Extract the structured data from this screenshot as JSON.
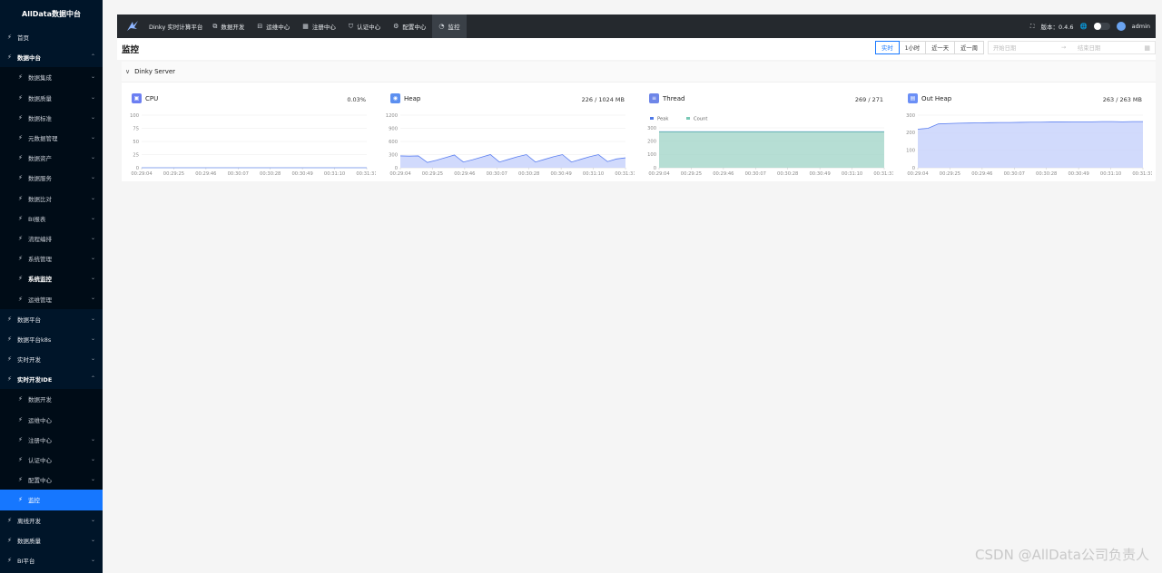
{
  "sidebar": {
    "title": "AllData数据中台",
    "items": [
      {
        "label": "首页",
        "level": 0,
        "expanded": null,
        "bold": false,
        "active": false
      },
      {
        "label": "数据中台",
        "level": 0,
        "expanded": true,
        "bold": true,
        "active": false
      },
      {
        "label": "数据集成",
        "level": 1,
        "expanded": false,
        "bold": false,
        "active": false
      },
      {
        "label": "数据质量",
        "level": 1,
        "expanded": false,
        "bold": false,
        "active": false
      },
      {
        "label": "数据标准",
        "level": 1,
        "expanded": false,
        "bold": false,
        "active": false
      },
      {
        "label": "元数据管理",
        "level": 1,
        "expanded": false,
        "bold": false,
        "active": false
      },
      {
        "label": "数据资产",
        "level": 1,
        "expanded": false,
        "bold": false,
        "active": false
      },
      {
        "label": "数据服务",
        "level": 1,
        "expanded": false,
        "bold": false,
        "active": false
      },
      {
        "label": "数据比对",
        "level": 1,
        "expanded": false,
        "bold": false,
        "active": false
      },
      {
        "label": "BI报表",
        "level": 1,
        "expanded": false,
        "bold": false,
        "active": false
      },
      {
        "label": "流程编排",
        "level": 1,
        "expanded": false,
        "bold": false,
        "active": false
      },
      {
        "label": "系统管理",
        "level": 1,
        "expanded": false,
        "bold": false,
        "active": false
      },
      {
        "label": "系统监控",
        "level": 1,
        "expanded": false,
        "bold": true,
        "active": false
      },
      {
        "label": "运维管理",
        "level": 1,
        "expanded": false,
        "bold": false,
        "active": false
      },
      {
        "label": "数据平台",
        "level": 0,
        "expanded": false,
        "bold": false,
        "active": false
      },
      {
        "label": "数据平台k8s",
        "level": 0,
        "expanded": false,
        "bold": false,
        "active": false
      },
      {
        "label": "实时开发",
        "level": 0,
        "expanded": false,
        "bold": false,
        "active": false
      },
      {
        "label": "实时开发IDE",
        "level": 0,
        "expanded": true,
        "bold": true,
        "active": false
      },
      {
        "label": "数据开发",
        "level": 1,
        "expanded": null,
        "bold": false,
        "active": false
      },
      {
        "label": "运维中心",
        "level": 1,
        "expanded": null,
        "bold": false,
        "active": false
      },
      {
        "label": "注册中心",
        "level": 1,
        "expanded": false,
        "bold": false,
        "active": false
      },
      {
        "label": "认证中心",
        "level": 1,
        "expanded": false,
        "bold": false,
        "active": false
      },
      {
        "label": "配置中心",
        "level": 1,
        "expanded": false,
        "bold": false,
        "active": false
      },
      {
        "label": "监控",
        "level": 1,
        "expanded": null,
        "bold": false,
        "active": true
      },
      {
        "label": "离线开发",
        "level": 0,
        "expanded": false,
        "bold": false,
        "active": false
      },
      {
        "label": "数据质量",
        "level": 0,
        "expanded": false,
        "bold": false,
        "active": false
      },
      {
        "label": "BI平台",
        "level": 0,
        "expanded": false,
        "bold": false,
        "active": false
      }
    ]
  },
  "topbar": {
    "brand": "Dinky 实时计算平台",
    "tabs": [
      {
        "label": "数据开发",
        "icon": "code-icon",
        "active": false
      },
      {
        "label": "运维中心",
        "icon": "devops-icon",
        "active": false
      },
      {
        "label": "注册中心",
        "icon": "registry-icon",
        "active": false
      },
      {
        "label": "认证中心",
        "icon": "shield-icon",
        "active": false
      },
      {
        "label": "配置中心",
        "icon": "gear-icon",
        "active": false
      },
      {
        "label": "监控",
        "icon": "dashboard-icon",
        "active": true
      }
    ],
    "version_label": "版本：0.4.6",
    "user": "admin"
  },
  "page": {
    "title": "监控",
    "range_buttons": [
      {
        "label": "实时",
        "active": true
      },
      {
        "label": "1小时",
        "active": false
      },
      {
        "label": "近一天",
        "active": false
      },
      {
        "label": "近一周",
        "active": false
      }
    ],
    "date_start_placeholder": "开始日期",
    "date_end_placeholder": "结束日期"
  },
  "panel": {
    "title": "Dinky Server"
  },
  "colors": {
    "accent": "#1677ff",
    "sidebar": "#001529",
    "topbar": "#25292e",
    "series_blue": "#5b7ff0",
    "series_green": "#7ec9b7"
  },
  "chart_data": [
    {
      "type": "line",
      "title": "CPU",
      "value_label": "0.03%",
      "icon": "cpu-icon",
      "x": [
        "00:29:04",
        "00:29:25",
        "00:29:46",
        "00:30:07",
        "00:30:28",
        "00:30:49",
        "00:31:10",
        "00:31:31"
      ],
      "y_ticks": [
        0,
        25,
        50,
        75,
        100
      ],
      "ylim": [
        0,
        100
      ],
      "series": [
        {
          "values": [
            0.03,
            0.03,
            0.03,
            0.03,
            0.03,
            0.03,
            0.03,
            0.03,
            0.03,
            0.03,
            0.03,
            0.03,
            0.03,
            0.03,
            0.03,
            0.03,
            0.03,
            0.03,
            0.03,
            0.03,
            0.03,
            0.03,
            0.03
          ]
        }
      ]
    },
    {
      "type": "area",
      "title": "Heap",
      "value_label": "226 / 1024 MB",
      "icon": "heap-icon",
      "x": [
        "00:29:04",
        "00:29:25",
        "00:29:46",
        "00:30:07",
        "00:30:28",
        "00:30:49",
        "00:31:10",
        "00:31:31"
      ],
      "y_ticks": [
        0,
        300,
        600,
        900,
        1200
      ],
      "ylim": [
        0,
        1200
      ],
      "series": [
        {
          "values": [
            270,
            265,
            270,
            120,
            170,
            230,
            290,
            130,
            180,
            240,
            300,
            130,
            190,
            250,
            300,
            130,
            190,
            250,
            300,
            130,
            190,
            250,
            300,
            140,
            200,
            226
          ]
        }
      ]
    },
    {
      "type": "area",
      "title": "Thread",
      "value_label": "269 / 271",
      "icon": "thread-icon",
      "x": [
        "00:29:04",
        "00:29:25",
        "00:29:46",
        "00:30:07",
        "00:30:28",
        "00:30:49",
        "00:31:10",
        "00:31:31"
      ],
      "y_ticks": [
        0,
        100,
        200,
        300
      ],
      "ylim": [
        0,
        300
      ],
      "legend": [
        "Peak",
        "Count"
      ],
      "series": [
        {
          "name": "Peak",
          "values": [
            271,
            271,
            271,
            271,
            271,
            271,
            271,
            271,
            271,
            271,
            271,
            271,
            271,
            271,
            271,
            271,
            271,
            271,
            271,
            271,
            271,
            271,
            271
          ]
        },
        {
          "name": "Count",
          "values": [
            269,
            269,
            269,
            269,
            269,
            269,
            269,
            269,
            269,
            269,
            269,
            269,
            269,
            269,
            269,
            269,
            269,
            269,
            269,
            269,
            269,
            269,
            269
          ]
        }
      ]
    },
    {
      "type": "area",
      "title": "Out Heap",
      "value_label": "263 / 263 MB",
      "icon": "offheap-icon",
      "x": [
        "00:29:04",
        "00:29:25",
        "00:29:46",
        "00:30:07",
        "00:30:28",
        "00:30:49",
        "00:31:10",
        "00:31:31"
      ],
      "y_ticks": [
        0,
        100,
        200,
        300
      ],
      "ylim": [
        0,
        300
      ],
      "series": [
        {
          "values": [
            220,
            225,
            250,
            252,
            254,
            255,
            256,
            257,
            258,
            258,
            259,
            260,
            260,
            261,
            261,
            262,
            262,
            262,
            263,
            263,
            262,
            263,
            263
          ]
        }
      ]
    }
  ],
  "watermark": "CSDN @AllData公司负责人"
}
